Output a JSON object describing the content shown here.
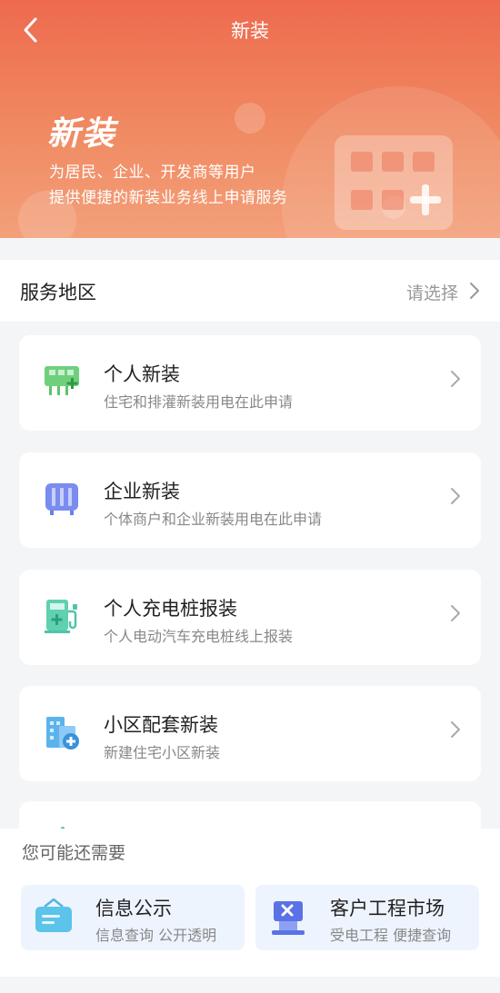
{
  "header": {
    "title": "新装",
    "back_icon": "chevron-left-icon"
  },
  "hero": {
    "title": "新装",
    "subtitle_line1": "为居民、企业、开发商等用户",
    "subtitle_line2": "提供便捷的新装业务线上申请服务",
    "illustration_icon": "building-plus-icon"
  },
  "region": {
    "label": "服务地区",
    "value": "请选择"
  },
  "services": [
    {
      "title": "个人新装",
      "desc": "住宅和排灌新装用电在此申请",
      "icon": "meter-plus-icon",
      "color": "#5cc46a"
    },
    {
      "title": "企业新装",
      "desc": "个体商户和企业新装用电在此申请",
      "icon": "transformer-icon",
      "color": "#6a7fe8"
    },
    {
      "title": "个人充电桩报装",
      "desc": "个人电动汽车充电桩线上报装",
      "icon": "charging-pile-icon",
      "color": "#4fc4a8"
    },
    {
      "title": "小区配套新装",
      "desc": "新建住宅小区新装",
      "icon": "residential-building-icon",
      "color": "#4aa8e8"
    }
  ],
  "recommend": {
    "title": "您可能还需要",
    "items": [
      {
        "title": "信息公示",
        "desc": "信息查询 公开透明",
        "icon": "notice-board-icon"
      },
      {
        "title": "客户工程市场",
        "desc": "受电工程 便捷查询",
        "icon": "engineering-market-icon"
      }
    ]
  },
  "colors": {
    "hero_top": "#ee6a4e",
    "hero_bottom": "#f3a07a",
    "recommend_bg": "#eef4fd"
  }
}
